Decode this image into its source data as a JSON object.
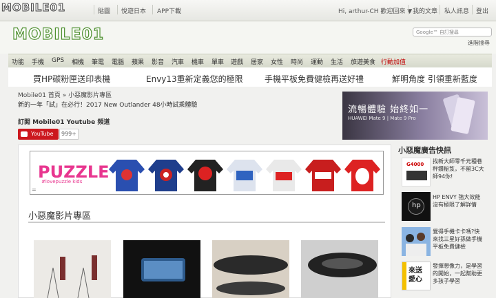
{
  "topbar": {
    "logo": "MOBILE01",
    "links": [
      "貼圖",
      "悅遊日本",
      "APP下載"
    ],
    "greeting": "Hi, arthur-CH 歡迎回來 ▼",
    "user_links": [
      "我的文章",
      "私人訊息",
      "登出"
    ]
  },
  "header": {
    "logo": "MOBILE01",
    "search_placeholder": "Google™ 自訂搜尋",
    "advanced_search": "進階搜尋"
  },
  "nav": {
    "items": [
      "功能",
      "手機",
      "GPS",
      "相機",
      "筆電",
      "電腦",
      "蘋果",
      "影音",
      "汽車",
      "機車",
      "單車",
      "遊戲",
      "居家",
      "女性",
      "時尚",
      "運動",
      "生活",
      "旅遊美食",
      "行動加值"
    ]
  },
  "promo": {
    "items": [
      "買HP碳粉匣送印表機",
      "Envy13重新定義您的極限",
      "手機平板免費健檢再送好禮",
      "鮮明角度 引領重新藍度"
    ]
  },
  "content": {
    "breadcrumb": "Mobile01 首頁 » 小惡魔影片專區",
    "news": "新的一年「試」在必行！2017 New Outlander 48小時試乘體驗",
    "subscribe_label": "訂閱 Mobile01 Youtube 頻道",
    "youtube_button": "YouTube",
    "youtube_count": "999+",
    "section_title": "小惡魔影片專區"
  },
  "banner": {
    "headline": "流暢體驗 始終如一",
    "subline": "HUAWEI Mate 9 | Mate 9 Pro"
  },
  "puzzle_ad": {
    "logo": "PUZZLE",
    "tagline": "#lovepuzzle kids",
    "equals": "="
  },
  "sidebar": {
    "heading": "小惡魔廣告快訊",
    "ads": [
      {
        "text": "找新大師零千元種卷秤鑽秘笈，不留3C大師94你!",
        "image_label": "G4000"
      },
      {
        "text": "HP ENVY 強大效能沒有極限了解詳情",
        "image_label": "hp"
      },
      {
        "text": "覺得手機卡卡嗎?快來找三星好孫做手機平板免費健檢",
        "image_label": ""
      },
      {
        "text": "發揮想像力，是學習的開始，一起幫助更多孩子學習",
        "image_label": "來送愛心"
      }
    ]
  },
  "colors": {
    "brand_green": "#4d8f2e",
    "youtube_red": "#cc181e",
    "nav_highlight": "#c00000"
  }
}
